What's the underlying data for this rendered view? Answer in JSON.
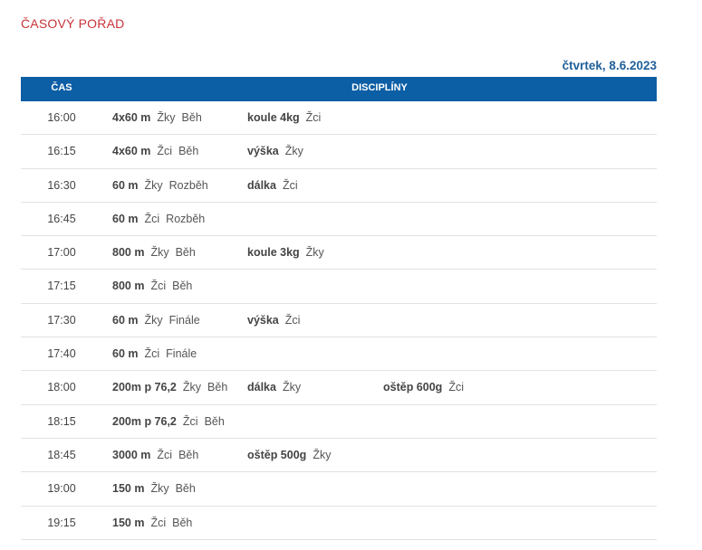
{
  "heading": "ČASOVÝ POŘAD",
  "date": "čtvrtek, 8.6.2023",
  "table": {
    "col_time": "ČAS",
    "col_disciplines": "DISCIPLÍNY",
    "rows": [
      {
        "time": "16:00",
        "events": [
          {
            "name": "4x60 m",
            "cat": "Žky",
            "phase": "Běh"
          },
          {
            "name": "koule 4kg",
            "cat": "Žci",
            "phase": ""
          }
        ]
      },
      {
        "time": "16:15",
        "events": [
          {
            "name": "4x60 m",
            "cat": "Žci",
            "phase": "Běh"
          },
          {
            "name": "výška",
            "cat": "Žky",
            "phase": ""
          }
        ]
      },
      {
        "time": "16:30",
        "events": [
          {
            "name": "60 m",
            "cat": "Žky",
            "phase": "Rozběh"
          },
          {
            "name": "dálka",
            "cat": "Žci",
            "phase": ""
          }
        ]
      },
      {
        "time": "16:45",
        "events": [
          {
            "name": "60 m",
            "cat": "Žci",
            "phase": "Rozběh"
          }
        ]
      },
      {
        "time": "17:00",
        "events": [
          {
            "name": "800 m",
            "cat": "Žky",
            "phase": "Běh"
          },
          {
            "name": "koule 3kg",
            "cat": "Žky",
            "phase": ""
          }
        ]
      },
      {
        "time": "17:15",
        "events": [
          {
            "name": "800 m",
            "cat": "Žci",
            "phase": "Běh"
          }
        ]
      },
      {
        "time": "17:30",
        "events": [
          {
            "name": "60 m",
            "cat": "Žky",
            "phase": "Finále"
          },
          {
            "name": "výška",
            "cat": "Žci",
            "phase": ""
          }
        ]
      },
      {
        "time": "17:40",
        "events": [
          {
            "name": "60 m",
            "cat": "Žci",
            "phase": "Finále"
          }
        ]
      },
      {
        "time": "18:00",
        "events": [
          {
            "name": "200m p 76,2",
            "cat": "Žky",
            "phase": "Běh"
          },
          {
            "name": "dálka",
            "cat": "Žky",
            "phase": ""
          },
          {
            "name": "oštěp 600g",
            "cat": "Žci",
            "phase": ""
          }
        ]
      },
      {
        "time": "18:15",
        "events": [
          {
            "name": "200m p 76,2",
            "cat": "Žci",
            "phase": "Běh"
          }
        ]
      },
      {
        "time": "18:45",
        "events": [
          {
            "name": "3000 m",
            "cat": "Žci",
            "phase": "Běh"
          },
          {
            "name": "oštěp 500g",
            "cat": "Žky",
            "phase": ""
          }
        ]
      },
      {
        "time": "19:00",
        "events": [
          {
            "name": "150 m",
            "cat": "Žky",
            "phase": "Běh"
          }
        ]
      },
      {
        "time": "19:15",
        "events": [
          {
            "name": "150 m",
            "cat": "Žci",
            "phase": "Běh"
          }
        ]
      }
    ]
  }
}
